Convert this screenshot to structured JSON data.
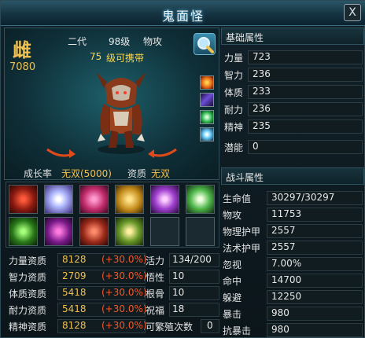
{
  "window": {
    "title": "鬼面怪",
    "close_glyph": "X"
  },
  "pet": {
    "char_badge": "雌",
    "id": "7080",
    "generation": "二代",
    "level": "98级",
    "attack_type": "物攻",
    "carry_level": "75",
    "carry_text": "级可携带",
    "growth_label": "成长率",
    "growth_value": "无双(5000)",
    "aptitude_label": "资质",
    "aptitude_value": "无双"
  },
  "pet_skill_icons": [
    "fire-orb-icon",
    "lightning-icon",
    "green-swirl-icon",
    "star-burst-icon"
  ],
  "skill_grid": {
    "row1": [
      "red-beast-skill",
      "ice-shard-skill",
      "pink-aura-skill",
      "golden-crest-skill",
      "violet-burst-skill",
      "green-bloom-skill"
    ],
    "row2": [
      "claw-strike-skill",
      "purple-dragon-skill",
      "crimson-rage-skill",
      "golden-wing-skill",
      "empty",
      "empty"
    ]
  },
  "aptitudes": [
    {
      "name": "力量资质",
      "value": "8128",
      "bonus": "(+30.0%)",
      "sub_name": "活力",
      "sub_value": "134/200"
    },
    {
      "name": "智力资质",
      "value": "2709",
      "bonus": "(+30.0%)",
      "sub_name": "悟性",
      "sub_value": "10"
    },
    {
      "name": "体质资质",
      "value": "5418",
      "bonus": "(+30.0%)",
      "sub_name": "根骨",
      "sub_value": "10"
    },
    {
      "name": "耐力资质",
      "value": "5418",
      "bonus": "(+30.0%)",
      "sub_name": "祝福",
      "sub_value": "18"
    },
    {
      "name": "精神资质",
      "value": "8128",
      "bonus": "(+30.0%)",
      "sub_name": "可繁殖次数",
      "sub_value": "0"
    }
  ],
  "basic_attrs": {
    "title": "基础属性",
    "rows": [
      {
        "name": "力量",
        "value": "723"
      },
      {
        "name": "智力",
        "value": "236"
      },
      {
        "name": "体质",
        "value": "233"
      },
      {
        "name": "耐力",
        "value": "236"
      },
      {
        "name": "精神",
        "value": "235"
      },
      {
        "name": "潜能",
        "value": "0"
      }
    ]
  },
  "battle_attrs": {
    "title": "战斗属性",
    "rows": [
      {
        "name": "生命值",
        "value": "30297/30297"
      },
      {
        "name": "物攻",
        "value": "11753"
      },
      {
        "name": "物理护甲",
        "value": "2557"
      },
      {
        "name": "法术护甲",
        "value": "2557"
      },
      {
        "name": "忽视",
        "value": "7.00%"
      },
      {
        "name": "命中",
        "value": "14700"
      },
      {
        "name": "躲避",
        "value": "12250"
      },
      {
        "name": "暴击",
        "value": "980"
      },
      {
        "name": "抗暴击",
        "value": "980"
      }
    ]
  }
}
